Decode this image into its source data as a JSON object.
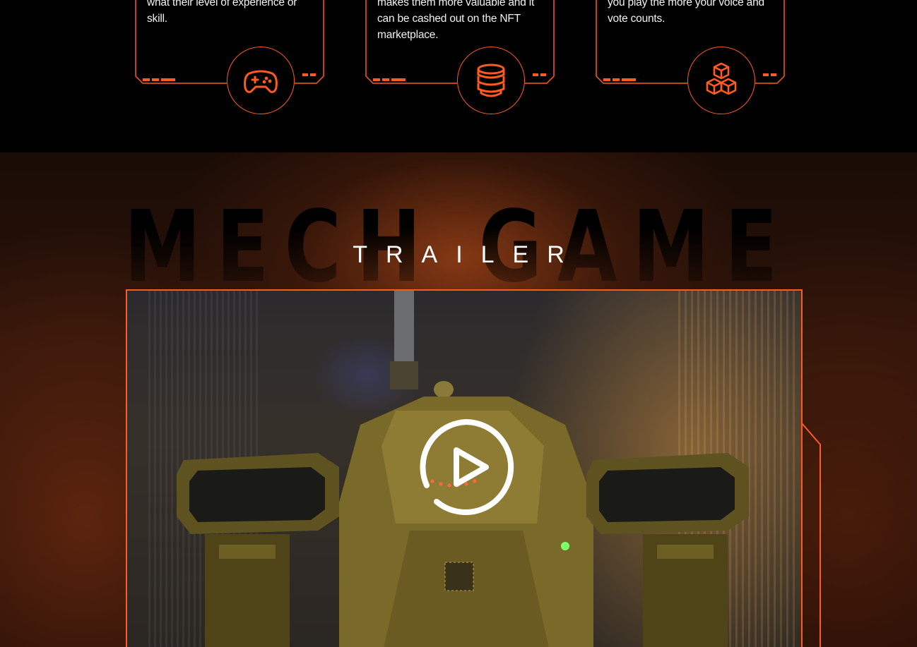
{
  "feature_cards": [
    {
      "text": "what their level of experience or skill.",
      "icon": "gamepad-icon"
    },
    {
      "text": "makes them more valuable and it can be cashed out on the NFT marketplace.",
      "icon": "coins-icon"
    },
    {
      "text": "you play the more your voice and vote counts.",
      "icon": "cubes-icon"
    }
  ],
  "trailer": {
    "background_title": "MECH GAME",
    "title": "TRAILER",
    "play_icon": "play-icon"
  },
  "colors": {
    "accent": "#ff5a1f",
    "background": "#000000",
    "text": "#ffffff"
  }
}
